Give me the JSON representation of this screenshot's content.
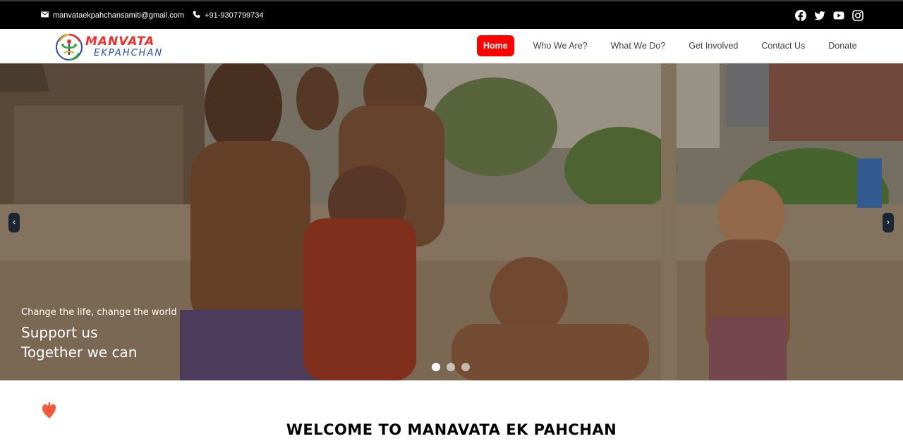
{
  "topbar": {
    "email": "manvataekpahchansamiti@gmail.com",
    "phone": "+91-9307799734",
    "social_icons": [
      "facebook-icon",
      "twitter-icon",
      "youtube-icon",
      "instagram-icon"
    ]
  },
  "logo": {
    "line1": "MANVATA",
    "line2": "EKPAHCHAN"
  },
  "nav": {
    "items": [
      {
        "label": "Home",
        "active": true
      },
      {
        "label": "Who We Are?",
        "active": false
      },
      {
        "label": "What We Do?",
        "active": false
      },
      {
        "label": "Get Involved",
        "active": false
      },
      {
        "label": "Contact Us",
        "active": false
      },
      {
        "label": "Donate",
        "active": false
      }
    ]
  },
  "hero": {
    "tagline": "Change the life, change the world",
    "line1": "Support us",
    "line2": "Together we can",
    "slide_count": 3,
    "active_slide": 1,
    "prev_arrow": "‹",
    "next_arrow": "›"
  },
  "welcome": {
    "title": "WELCOME TO MANAVATA EK PAHCHAN"
  },
  "colors": {
    "topbar_bg": "#000000",
    "active_nav": "#ff0000",
    "logo_red": "#e5322d",
    "logo_blue": "#2b4fa0",
    "heart": "#f15a3a"
  }
}
